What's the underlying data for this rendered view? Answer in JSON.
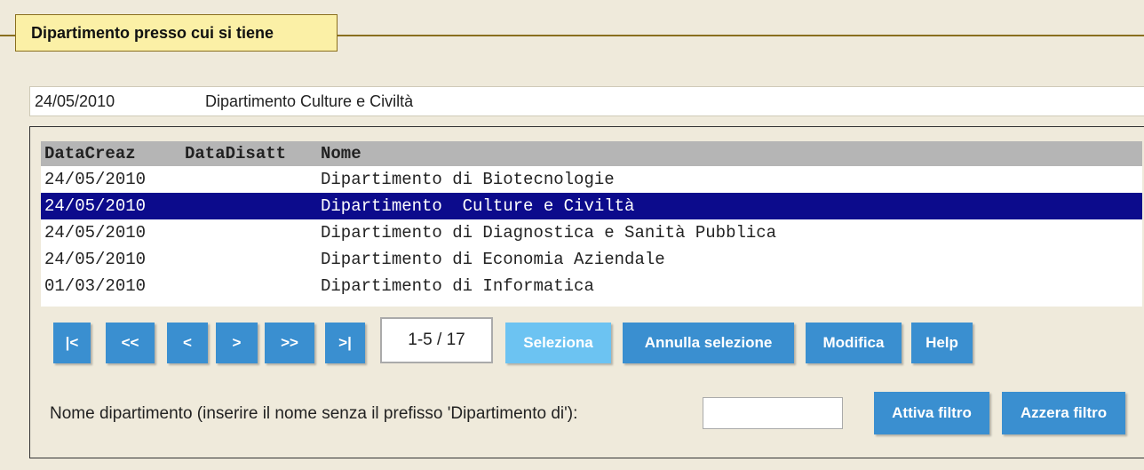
{
  "legend": {
    "title": "Dipartimento presso cui si tiene"
  },
  "selected": {
    "date": "24/05/2010",
    "name": "Dipartimento  Culture e Civiltà"
  },
  "grid": {
    "headers": [
      "DataCreaz",
      "DataDisatt",
      "Nome"
    ],
    "rows": [
      {
        "datacreaz": "24/05/2010",
        "datadisatt": "",
        "nome": "Dipartimento di Biotecnologie"
      },
      {
        "datacreaz": "24/05/2010",
        "datadisatt": "",
        "nome": "Dipartimento  Culture e Civiltà"
      },
      {
        "datacreaz": "24/05/2010",
        "datadisatt": "",
        "nome": "Dipartimento di Diagnostica e Sanità Pubblica"
      },
      {
        "datacreaz": "24/05/2010",
        "datadisatt": "",
        "nome": "Dipartimento di Economia Aziendale"
      },
      {
        "datacreaz": "01/03/2010",
        "datadisatt": "",
        "nome": "Dipartimento di Informatica"
      }
    ],
    "selected_row_index": 1
  },
  "toolbar": {
    "first": "|<",
    "prev_page": "<<",
    "prev": "<",
    "next": ">",
    "next_page": ">>",
    "last": ">|",
    "page_info": "1-5 / 17",
    "seleziona": "Seleziona",
    "annulla": "Annulla selezione",
    "modifica": "Modifica",
    "help": "Help"
  },
  "filter": {
    "label": "Nome dipartimento (inserire il nome senza il prefisso 'Dipartimento di'):",
    "value": "",
    "attiva": "Attiva filtro",
    "azzera": "Azzera filtro"
  },
  "colors": {
    "button": "#3a8fd0",
    "button_disabled": "#6cc3f2",
    "selected_row": "#0c0b8c",
    "legend_bg": "#fbf0a6",
    "page_bg": "#efeadb"
  }
}
